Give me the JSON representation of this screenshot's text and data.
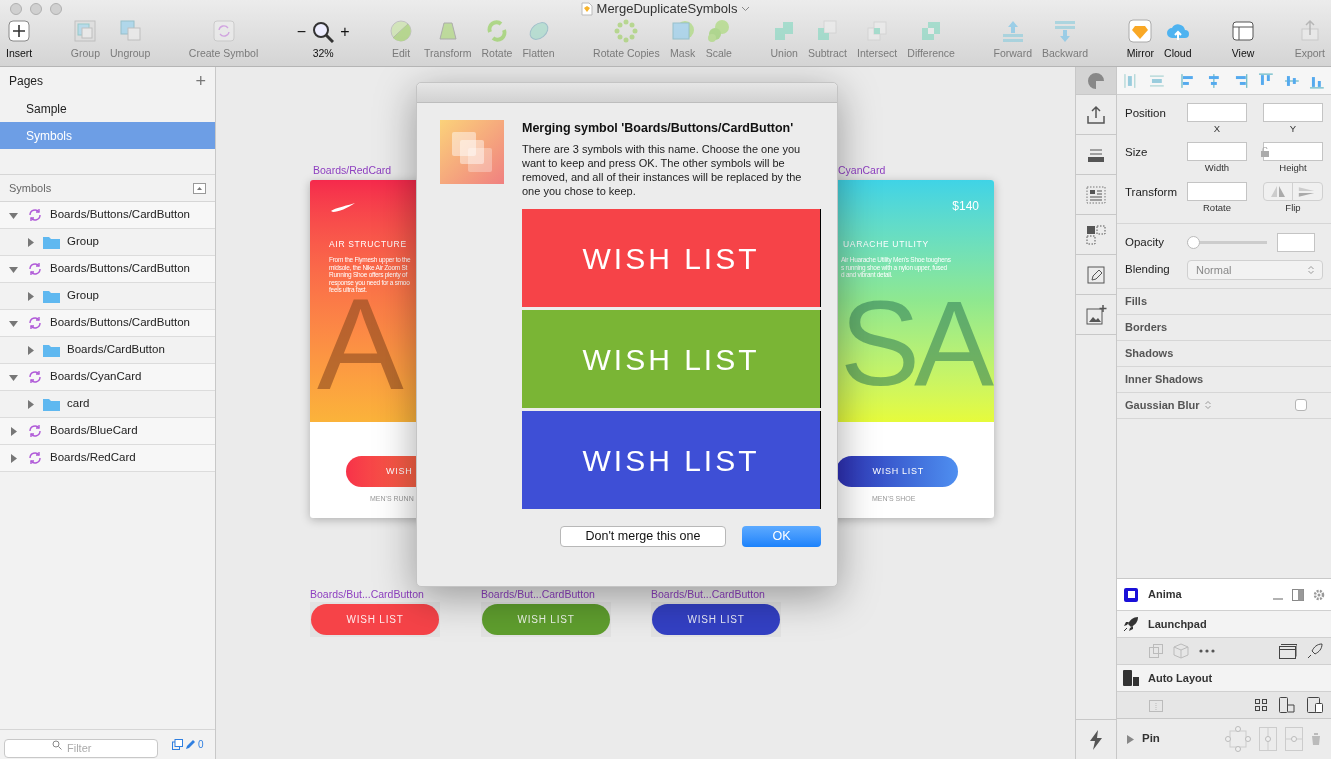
{
  "window": {
    "title": "MergeDuplicateSymbols"
  },
  "toolbar": {
    "groups": [
      [
        {
          "label": "Insert",
          "disabled": false,
          "kind": "tool"
        }
      ],
      [
        {
          "label": "Group",
          "disabled": true,
          "kind": "tool"
        },
        {
          "label": "Ungroup",
          "disabled": true,
          "kind": "tool"
        }
      ],
      [
        {
          "label": "Create Symbol",
          "disabled": true,
          "kind": "tool"
        }
      ],
      [
        {
          "label": "32%",
          "disabled": false,
          "kind": "zoom",
          "minus": "−",
          "plus": "+"
        }
      ],
      [
        {
          "label": "Edit",
          "disabled": true,
          "kind": "tool"
        },
        {
          "label": "Transform",
          "disabled": true,
          "kind": "tool"
        },
        {
          "label": "Rotate",
          "disabled": true,
          "kind": "tool"
        },
        {
          "label": "Flatten",
          "disabled": true,
          "kind": "tool"
        }
      ],
      [
        {
          "label": "Rotate Copies",
          "disabled": true,
          "kind": "tool"
        },
        {
          "label": "Mask",
          "disabled": true,
          "kind": "tool"
        },
        {
          "label": "Scale",
          "disabled": true,
          "kind": "tool"
        }
      ],
      [
        {
          "label": "Union",
          "disabled": true,
          "kind": "tool"
        },
        {
          "label": "Subtract",
          "disabled": true,
          "kind": "tool"
        },
        {
          "label": "Intersect",
          "disabled": true,
          "kind": "tool"
        },
        {
          "label": "Difference",
          "disabled": true,
          "kind": "tool"
        }
      ],
      [
        {
          "label": "Forward",
          "disabled": true,
          "kind": "tool"
        },
        {
          "label": "Backward",
          "disabled": true,
          "kind": "tool"
        }
      ],
      [
        {
          "label": "Mirror",
          "disabled": false,
          "kind": "tool"
        },
        {
          "label": "Cloud",
          "disabled": false,
          "kind": "tool"
        }
      ],
      [
        {
          "label": "View",
          "disabled": false,
          "kind": "tool"
        }
      ],
      [
        {
          "label": "Export",
          "disabled": true,
          "kind": "tool"
        }
      ]
    ]
  },
  "pages": {
    "title": "Pages",
    "add": "+",
    "items": [
      {
        "label": "Sample",
        "selected": false
      },
      {
        "label": "Symbols",
        "selected": true
      }
    ]
  },
  "layers": {
    "title": "Symbols",
    "items": [
      {
        "label": "Boards/Buttons/CardButton",
        "kind": "symbol",
        "expanded": true,
        "children": [
          {
            "label": "Group",
            "kind": "folder",
            "expanded": false
          }
        ]
      },
      {
        "label": "Boards/Buttons/CardButton",
        "kind": "symbol",
        "expanded": true,
        "children": [
          {
            "label": "Group",
            "kind": "folder",
            "expanded": false
          }
        ]
      },
      {
        "label": "Boards/Buttons/CardButton",
        "kind": "symbol",
        "expanded": true,
        "children": [
          {
            "label": "Boards/CardButton",
            "kind": "folder",
            "expanded": false
          }
        ]
      },
      {
        "label": "Boards/CyanCard",
        "kind": "symbol",
        "expanded": true,
        "children": [
          {
            "label": "card",
            "kind": "folder",
            "expanded": false
          }
        ]
      },
      {
        "label": "Boards/BlueCard",
        "kind": "symbol",
        "expanded": false
      },
      {
        "label": "Boards/RedCard",
        "kind": "symbol",
        "expanded": false
      }
    ]
  },
  "filter": {
    "placeholder": "Filter",
    "count": "0"
  },
  "red_card": {
    "label": "Boards/RedCard",
    "heading": "AIR STRUCTURE",
    "description": [
      "From the Flymesh upper to the",
      "midsole, the Nike Air Zoom St",
      "Running Shoe offers plenty of",
      "response you need for a smoo",
      "feels ultra fast."
    ],
    "letter": "A",
    "button": "WISH",
    "caption": "MEN'S RUNN"
  },
  "cyan_card": {
    "label": "CyanCard",
    "price": "$140",
    "heading": "UARACHE UTILITY",
    "description": [
      "Air Huarache Utility Men's Shoe toughens",
      "s running shoe with a nylon upper, fused",
      "d and vibrant detail."
    ],
    "letter": "SA",
    "button": "WISH LIST",
    "caption": "MEN'S SHOE"
  },
  "button_symbols": [
    {
      "label": "Boards/But...CardButton",
      "text": "WISH LIST",
      "color": "#f64348"
    },
    {
      "label": "Boards/But...CardButton",
      "text": "WISH LIST",
      "color": "#5f9e2e"
    },
    {
      "label": "Boards/But...CardButton",
      "text": "WISH LIST",
      "color": "#3340c4"
    }
  ],
  "dialog": {
    "title": "Merging symbol 'Boards/Buttons/CardButton'",
    "message": "There are 3 symbols with this name. Choose the one you want to keep and press OK. The other symbols will be removed, and all of their instances will be replaced by the one you chose to keep.",
    "options": [
      {
        "text": "WISH LIST",
        "color": "#f64348"
      },
      {
        "text": "WISH LIST",
        "color": "#7ab535"
      },
      {
        "text": "WISH LIST",
        "color": "#3e4fd6"
      }
    ],
    "cancel": "Don't merge this one",
    "ok": "OK"
  },
  "inspector": {
    "rows": [
      {
        "label": "Position",
        "inputs": [
          "X",
          "Y"
        ]
      },
      {
        "label": "Size",
        "inputs": [
          "Width",
          "Height"
        ],
        "lock": true
      },
      {
        "label": "Transform",
        "inputs": [
          "Rotate"
        ],
        "flip": "Flip"
      }
    ],
    "opacity": {
      "label": "Opacity",
      "level": 0
    },
    "blending": {
      "label": "Blending",
      "value": "Normal"
    },
    "sections": [
      "Fills",
      "Borders",
      "Shadows",
      "Inner Shadows"
    ],
    "blur": {
      "label": "Gaussian Blur",
      "checked": false
    }
  },
  "plugins": {
    "anima": "Anima",
    "launchpad": "Launchpad",
    "auto_layout": "Auto Layout",
    "pin": "Pin"
  }
}
